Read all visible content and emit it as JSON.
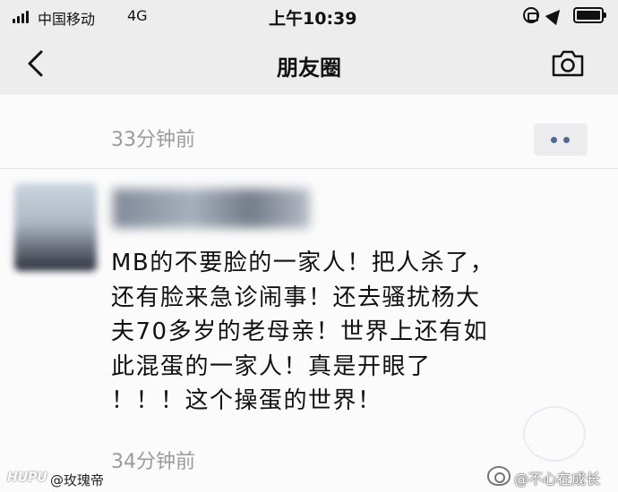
{
  "status_bar": {
    "carrier": "中国移动",
    "network": "4G",
    "time": "上午10:39"
  },
  "nav": {
    "title": "朋友圈"
  },
  "posts": [
    {
      "time": "33分钟前"
    },
    {
      "text_lines": [
        "MB的不要脸的一家人！把人杀了，",
        "还有脸来急诊闹事！还去骚扰杨大",
        "夫70多岁的老母亲！世界上还有如",
        "此混蛋的一家人！真是开眼了",
        "！！！这个操蛋的世界！"
      ],
      "time": "34分钟前"
    }
  ],
  "footer": {
    "hupu_logo": "HUPU",
    "source_handle": "@玫瑰帝",
    "weibo_handle": "@不心在成长"
  },
  "icons": {
    "back": "chevron-left-icon",
    "camera": "camera-icon",
    "more": "more-dots-icon"
  },
  "colors": {
    "link_blue": "#4e6a93",
    "time_gray": "#9b9b9b"
  }
}
